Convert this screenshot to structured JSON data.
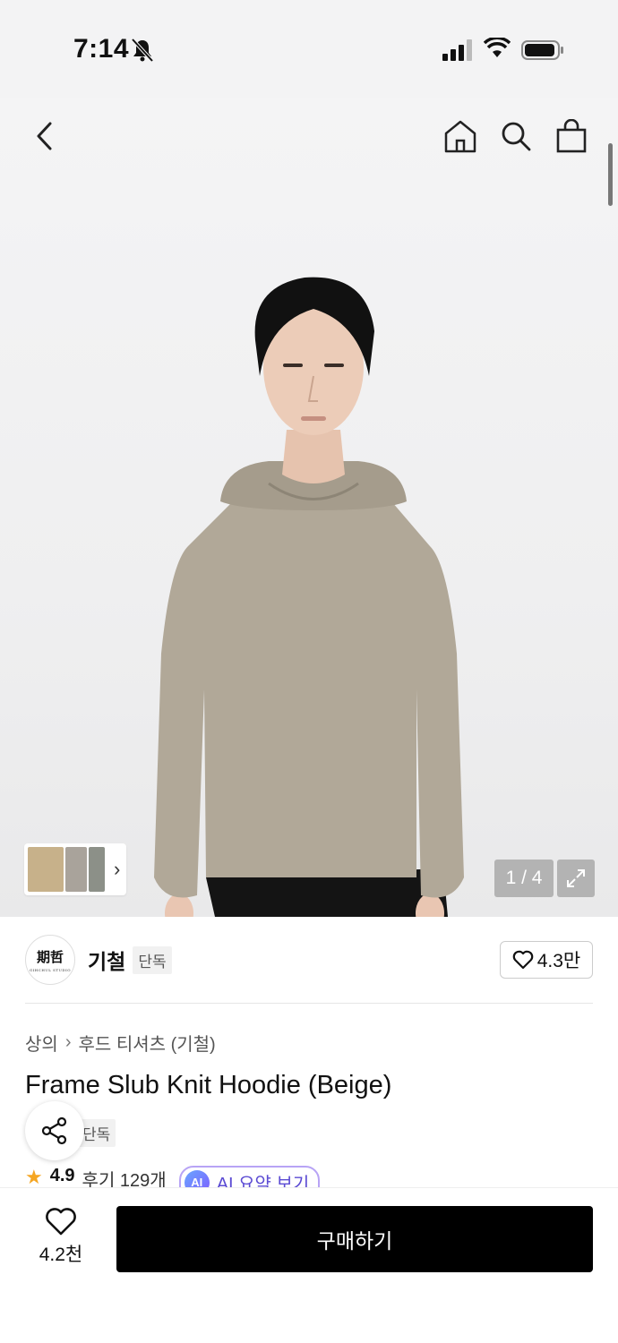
{
  "status": {
    "time": "7:14"
  },
  "header": {
    "back_icon": "chevron-left-icon",
    "home_icon": "home-icon",
    "search_icon": "search-icon",
    "cart_icon": "shopping-bag-icon"
  },
  "gallery": {
    "counter": "1 / 4",
    "current_index": 1,
    "total": 4,
    "thumbnails": [
      {
        "color": "#c7b18a"
      },
      {
        "color": "#a9a39b"
      },
      {
        "color": "#8c9088"
      }
    ]
  },
  "brand": {
    "logo_text": "期哲",
    "logo_subtext": "GIHCHUL STUDIO",
    "name": "기철",
    "badge": "단독",
    "likes": "4.3만"
  },
  "breadcrumb": {
    "category": "상의",
    "subcategory": "후드 티셔츠 (기철)"
  },
  "product": {
    "title": "Frame Slub Knit Hoodie (Beige)",
    "badge": "단독",
    "rating": "4.9",
    "reviews": "후기 129개",
    "ai_icon_label": "AI",
    "ai_summary_label": "AI 요약 보기"
  },
  "bottom_bar": {
    "like_count": "4.2천",
    "buy_label": "구매하기"
  },
  "colors": {
    "accent_purple": "#5b4bd3",
    "star": "#f5a623",
    "buy_button": "#000000"
  }
}
